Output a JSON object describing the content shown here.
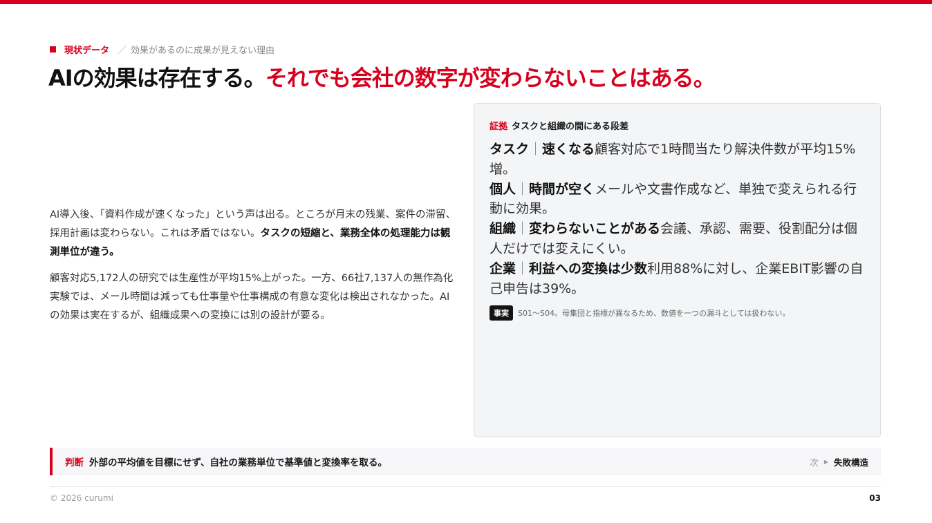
{
  "header": {
    "label": "現状データ",
    "sub": "効果があるのに成果が見えない理由",
    "headline_a": "AIの効果は存在する。",
    "headline_b": "それでも会社の数字が変わらないことはある。"
  },
  "body": {
    "p1_a": "AI導入後、「資料作成が速くなった」という声は出る。ところが月末の残業、案件の滞留、採用計画は変わらない。これは矛盾ではない。",
    "p1_b": "タスクの短縮と、業務全体の処理能力は観測単位が違う。",
    "p2": "顧客対応5,172人の研究では生産性が平均15%上がった。一方、66社7,137人の無作為化実験では、メール時間は減っても仕事量や仕事構成の有意な変化は検出されなかった。AIの効果は実在するが、組織成果への変換には別の設計が要る。"
  },
  "card": {
    "tag": "証拠",
    "title": "タスクと組織の間にある段差",
    "rows": [
      {
        "level": "タスク",
        "sep": "｜",
        "key": "速くなる",
        "text": "顧客対応で1時間当たり解決件数が平均15%増。"
      },
      {
        "level": "個人",
        "sep": "｜",
        "key": "時間が空く",
        "text": "メールや文書作成など、単独で変えられる行動に効果。"
      },
      {
        "level": "組織",
        "sep": "｜",
        "key": "変わらないことがある",
        "text": "会議、承認、需要、役割配分は個人だけでは変えにくい。"
      },
      {
        "level": "企業",
        "sep": "｜",
        "key": "利益への変換は少数",
        "text": "利用88%に対し、企業EBIT影響の自己申告は39%。"
      }
    ],
    "note_badge": "事実",
    "note_text": "S01〜S04。母集団と指標が異なるため、数値を一つの漏斗としては扱わない。"
  },
  "judgement": {
    "tag": "判断",
    "text": "外部の平均値を目標にせず、自社の業務単位で基準値と変換率を取る。",
    "next_label": "次",
    "next_title": "失敗構造"
  },
  "footer": {
    "copyright": "© 2026 curumi",
    "page": "03"
  },
  "colors": {
    "accent": "#d7001d",
    "card_bg": "#f4f5f7"
  }
}
